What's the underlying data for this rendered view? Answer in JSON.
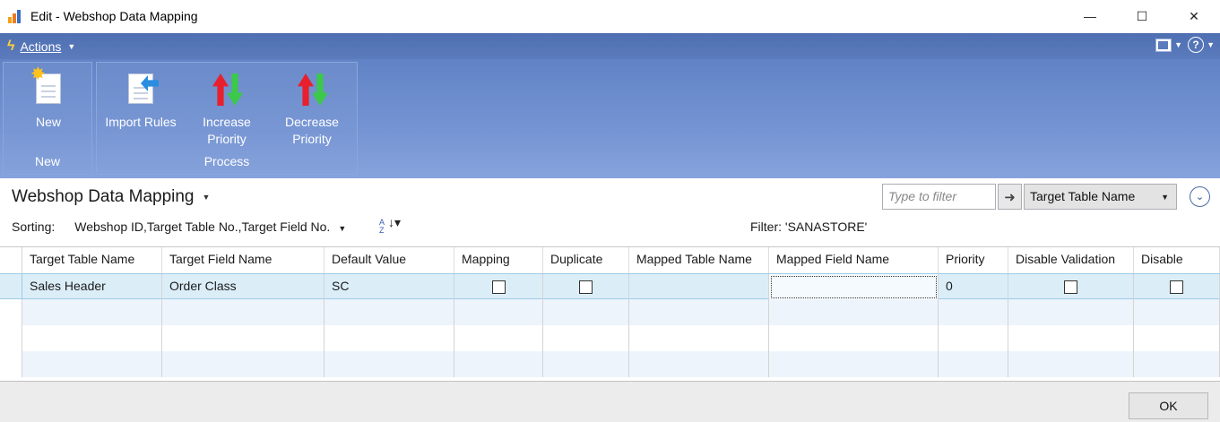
{
  "window": {
    "title": "Edit - Webshop Data Mapping",
    "minimize_glyph": "—",
    "maximize_glyph": "☐",
    "close_glyph": "✕"
  },
  "actions_bar": {
    "label": "Actions",
    "icon": "lightning-icon"
  },
  "ribbon": {
    "groups": [
      {
        "label": "New",
        "buttons": [
          {
            "label": "New",
            "icon": "new-document-icon"
          }
        ]
      },
      {
        "label": "Process",
        "buttons": [
          {
            "label": "Import Rules",
            "icon": "import-icon"
          },
          {
            "label": "Increase Priority",
            "icon": "increase-priority-icon"
          },
          {
            "label": "Decrease Priority",
            "icon": "decrease-priority-icon"
          }
        ]
      }
    ]
  },
  "page": {
    "title": "Webshop Data Mapping",
    "filter_placeholder": "Type to filter",
    "filter_field": "Target Table Name",
    "sorting_label": "Sorting:",
    "sorting_value": "Webshop ID,Target Table No.,Target Field No.",
    "filter_text": "Filter: 'SANASTORE'"
  },
  "grid": {
    "columns": [
      "Target Table Name",
      "Target Field Name",
      "Default Value",
      "Mapping",
      "Duplicate",
      "Mapped Table Name",
      "Mapped Field Name",
      "Priority",
      "Disable Validation",
      "Disable"
    ],
    "rows": [
      {
        "target_table_name": "Sales Header",
        "target_field_name": "Order Class",
        "default_value": "SC",
        "mapping": false,
        "duplicate": false,
        "mapped_table_name": "",
        "mapped_field_name": "",
        "priority": "0",
        "disable_validation": false,
        "disable": false
      }
    ]
  },
  "footer": {
    "ok_label": "OK"
  },
  "colors": {
    "ribbon_top": "#6183c6",
    "actions_bar": "#4e6fb1",
    "selected_row": "#dbeef8"
  }
}
